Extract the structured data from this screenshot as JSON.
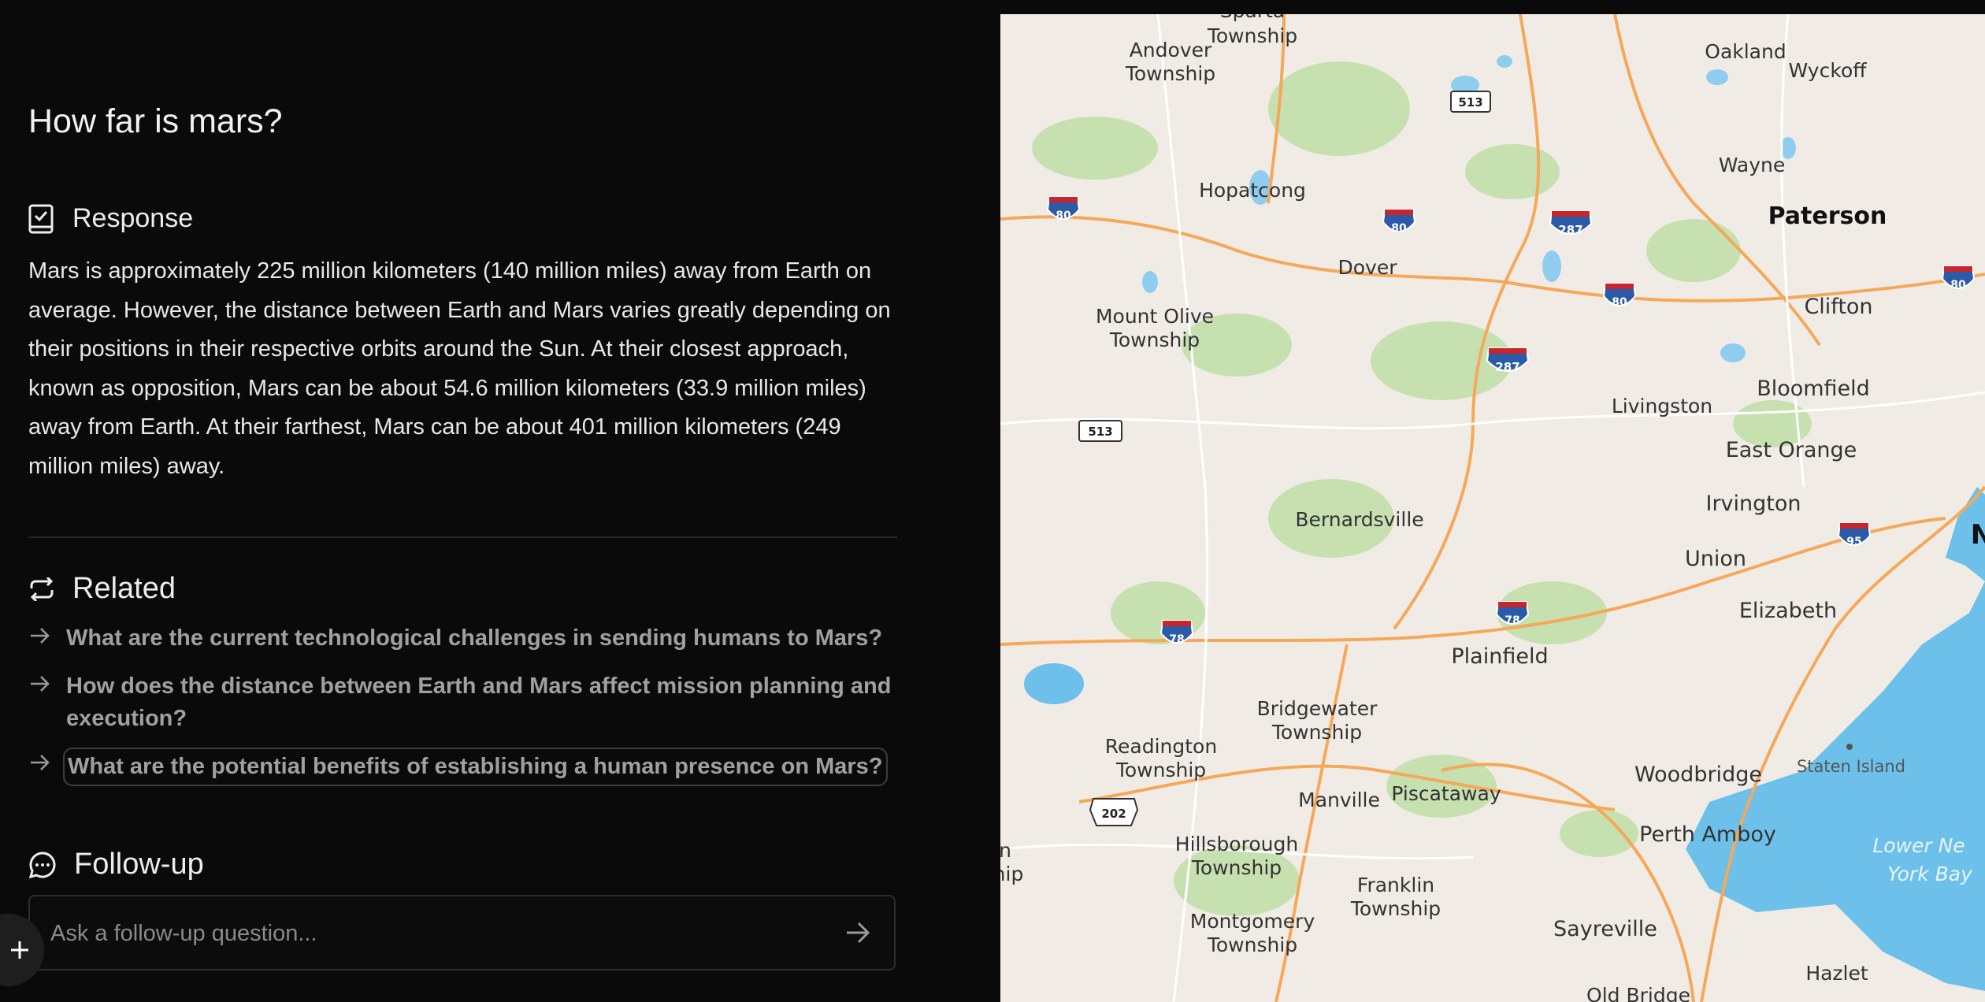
{
  "query": "How far is mars?",
  "response": {
    "heading": "Response",
    "text": "Mars is approximately 225 million kilometers (140 million miles) away from Earth on average. However, the distance between Earth and Mars varies greatly depending on their positions in their respective orbits around the Sun. At their closest approach, known as opposition, Mars can be about 54.6 million kilometers (33.9 million miles) away from Earth. At their farthest, Mars can be about 401 million kilometers (249 million miles) away."
  },
  "related": {
    "heading": "Related",
    "items": [
      "What are the current technological challenges in sending humans to Mars?",
      "How does the distance between Earth and Mars affect mission planning and execution?",
      "What are the potential benefits of establishing a human presence on Mars?"
    ]
  },
  "followup": {
    "heading": "Follow-up",
    "placeholder": "Ask a follow-up question..."
  },
  "map": {
    "labels": {
      "sparta": "Sparta",
      "sparta_twp": "Township",
      "andover": "Andover",
      "andover_twp": "Township",
      "oakland": "Oakland",
      "wyckoff": "Wyckoff",
      "wayne": "Wayne",
      "hopatcong": "Hopatcong",
      "paterson": "Paterson",
      "dover": "Dover",
      "clifton": "Clifton",
      "mount_olive": "Mount Olive",
      "mount_olive_twp": "Township",
      "livingston": "Livingston",
      "bloomfield": "Bloomfield",
      "east_orange": "East Orange",
      "irvington": "Irvington",
      "bernardsville": "Bernardsville",
      "union": "Union",
      "newark_partial": "N",
      "elizabeth": "Elizabeth",
      "plainfield": "Plainfield",
      "bridgewater": "Bridgewater",
      "bridgewater_twp": "Township",
      "readington": "Readington",
      "readington_twp": "Township",
      "woodbridge": "Woodbridge",
      "staten_island": "Staten Island",
      "manville": "Manville",
      "piscataway": "Piscataway",
      "perth_amboy": "Perth Amboy",
      "lower_ny_bay_1": "Lower Ne",
      "lower_ny_bay_2": "York Bay",
      "hillsborough": "Hillsborough",
      "hillsborough_twp": "Township",
      "franklin": "Franklin",
      "franklin_twp": "Township",
      "left_partial_1": "n",
      "left_partial_2": "hip",
      "montgomery": "Montgomery",
      "montgomery_twp": "Township",
      "sayreville": "Sayreville",
      "hazlet": "Hazlet",
      "old_bridge": "Old Bridge"
    },
    "shields": {
      "i80": "80",
      "i287": "287",
      "i78": "78",
      "i95": "95",
      "r513": "513",
      "us202": "202"
    }
  }
}
